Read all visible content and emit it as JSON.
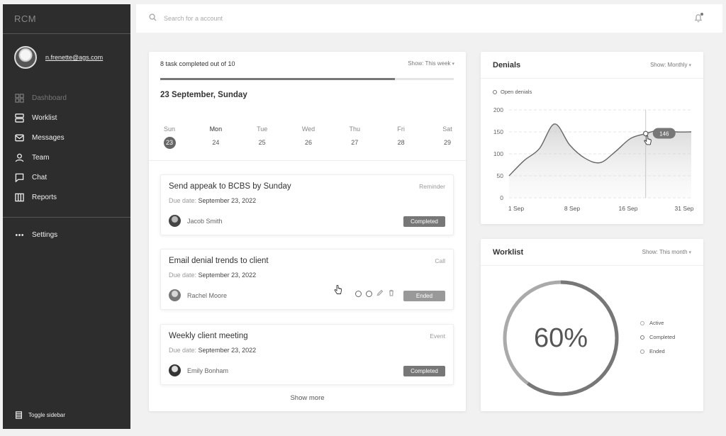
{
  "app": {
    "logo": "RCM"
  },
  "user": {
    "email": "n.frenette@ags.com"
  },
  "sidebar": {
    "items": [
      {
        "label": "Dashboard",
        "icon": "dashboard-icon"
      },
      {
        "label": "Worklist",
        "icon": "worklist-icon"
      },
      {
        "label": "Messages",
        "icon": "mail-icon"
      },
      {
        "label": "Team",
        "icon": "user-icon"
      },
      {
        "label": "Chat",
        "icon": "chat-icon"
      },
      {
        "label": "Reports",
        "icon": "reports-icon"
      }
    ],
    "settings": "Settings",
    "toggle": "Toggle sidebar"
  },
  "search": {
    "placeholder": "Search for a account"
  },
  "tasks": {
    "summary": "8 task completed out of 10",
    "completed": 8,
    "total": 10,
    "show": "Show: This week",
    "date_title": "23 September, Sunday",
    "week": [
      {
        "name": "Sun",
        "num": "23"
      },
      {
        "name": "Mon",
        "num": "24"
      },
      {
        "name": "Tue",
        "num": "25"
      },
      {
        "name": "Wed",
        "num": "26"
      },
      {
        "name": "Thu",
        "num": "27"
      },
      {
        "name": "Fri",
        "num": "28"
      },
      {
        "name": "Sat",
        "num": "29"
      }
    ],
    "list": [
      {
        "title": "Send appeak to BCBS  by Sunday",
        "type": "Reminder",
        "due_label": "Due date:",
        "due": "September 23, 2022",
        "assignee": "Jacob Smith",
        "status": "Completed"
      },
      {
        "title": "Email denial trends to client",
        "type": "Call",
        "due_label": "Due date:",
        "due": "September 23, 2022",
        "assignee": "Rachel Moore",
        "status": "Ended"
      },
      {
        "title": "Weekly client meeting",
        "type": "Event",
        "due_label": "Due date:",
        "due": "September 23, 2022",
        "assignee": "Emily Bonham",
        "status": "Completed"
      }
    ],
    "show_more": "Show more"
  },
  "denials": {
    "title": "Denials",
    "show": "Show: Monthly",
    "legend": "Open denials",
    "tooltip": "146"
  },
  "chart_data": {
    "type": "area",
    "title": "Denials",
    "series": [
      {
        "name": "Open denials",
        "x": [
          0,
          1,
          2,
          3,
          4,
          5,
          6,
          7,
          8,
          9,
          10,
          11,
          12
        ],
        "values": [
          50,
          85,
          112,
          168,
          120,
          90,
          80,
          105,
          135,
          146,
          155,
          150,
          150
        ]
      }
    ],
    "xticks": [
      "1 Sep",
      "8 Sep",
      "16 Sep",
      "31 Sep"
    ],
    "yticks": [
      0,
      50,
      100,
      150,
      200
    ],
    "ylim": [
      0,
      200
    ],
    "grid": true,
    "legend_position": "top-left"
  },
  "worklist": {
    "title": "Worklist",
    "show": "Show: This month",
    "percent_label": "60%",
    "percent": 60,
    "legend": [
      "Active",
      "Completed",
      "Ended"
    ]
  }
}
